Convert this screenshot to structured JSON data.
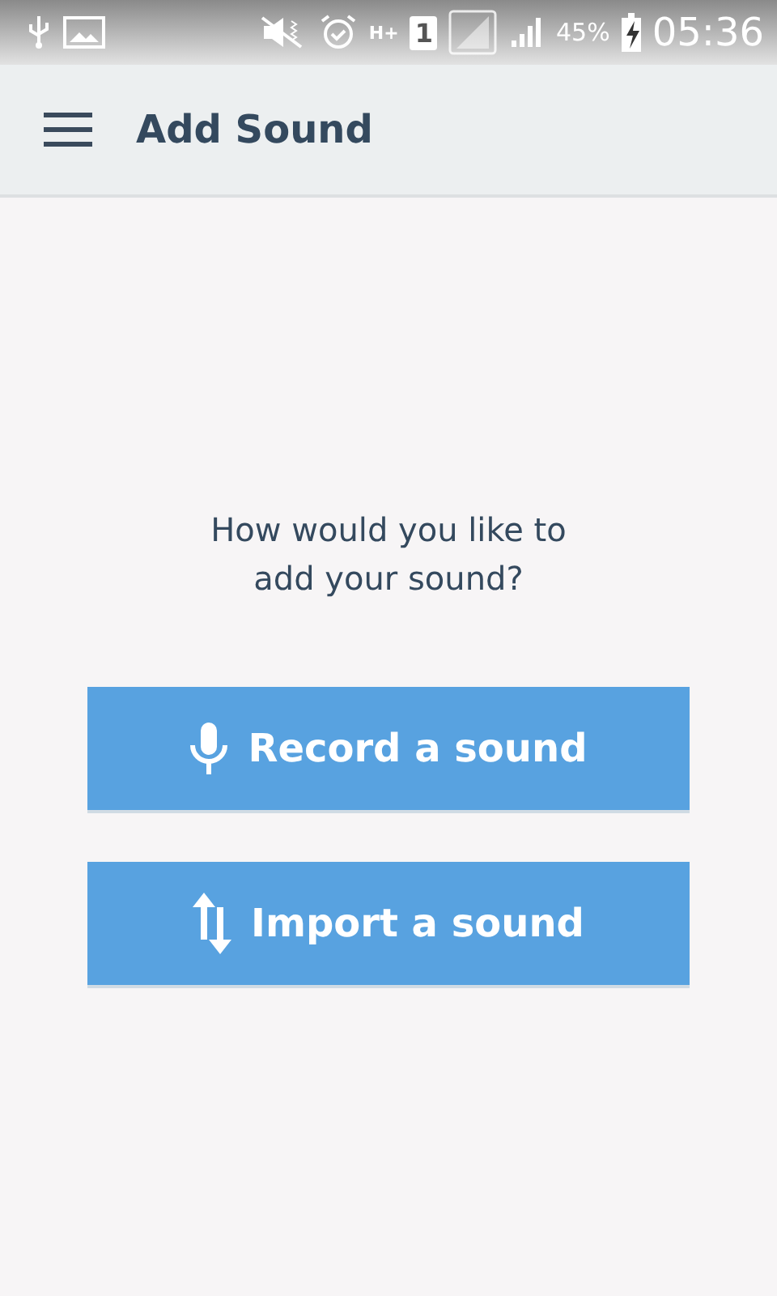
{
  "status_bar": {
    "network_type": "H+",
    "sim_slot": "1",
    "battery": "45%",
    "time": "05:36"
  },
  "app_bar": {
    "title": "Add Sound"
  },
  "prompt": "How would you like to add your sound?",
  "buttons": [
    {
      "kind": "record",
      "label": "Record a sound"
    },
    {
      "kind": "import",
      "label": "Import a sound"
    }
  ]
}
